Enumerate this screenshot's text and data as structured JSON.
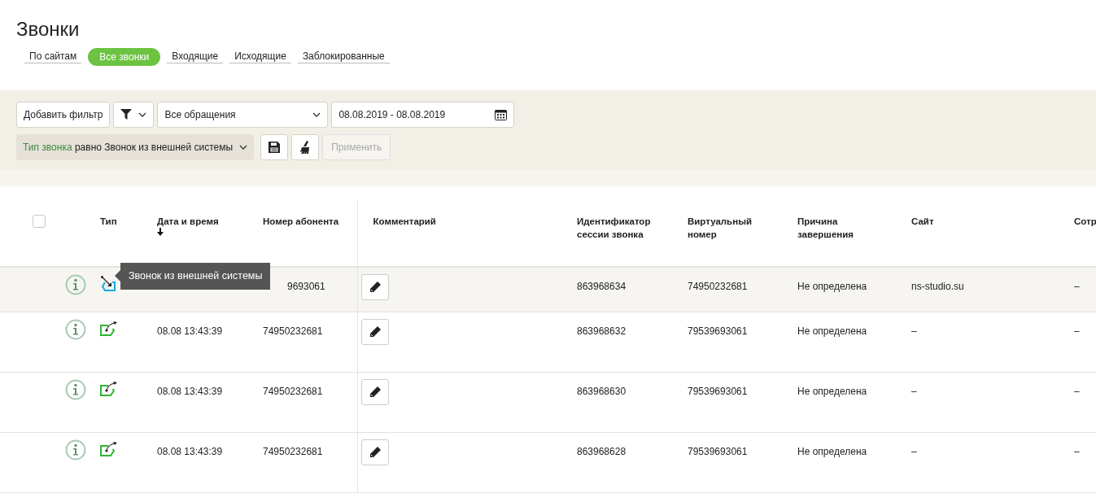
{
  "title": "Звонки",
  "tabs": [
    {
      "label": "По сайтам",
      "selected": false
    },
    {
      "label": "Все звонки",
      "selected": true
    },
    {
      "label": "Входящие",
      "selected": false
    },
    {
      "label": "Исходящие",
      "selected": false
    },
    {
      "label": "Заблокированные",
      "selected": false
    }
  ],
  "filters": {
    "add_button": "Добавить фильтр",
    "request_select": "Все обращения",
    "date_range": "08.08.2019 - 08.08.2019",
    "condition": {
      "field": "Тип звонка",
      "text": "равно Звонок из внешней системы"
    },
    "apply_button": "Применить",
    "apply_disabled": true
  },
  "table": {
    "columns": [
      {
        "label": "Тип",
        "sorted": false
      },
      {
        "label": "Дата и время",
        "sorted": true
      },
      {
        "label": "Номер абонента",
        "sorted": false
      },
      {
        "label": "Комментарий",
        "sorted": false
      },
      {
        "label": "Идентификатор сессии звонка",
        "sorted": false
      },
      {
        "label": "Виртуальный номер",
        "sorted": false
      },
      {
        "label": "Причина завершения",
        "sorted": false
      },
      {
        "label": "Сайт",
        "sorted": false
      },
      {
        "label": "Сотр",
        "sorted": false
      }
    ],
    "select_all_checked": false,
    "rows": [
      {
        "kind": "external",
        "highlighted": true,
        "tooltip": "Звонок из внешней системы",
        "number": "9693061",
        "session": "863968634",
        "virtual": "74950232681",
        "reason": "Не определена",
        "site": "ns-studio.su",
        "employee": "–"
      },
      {
        "kind": "outgoing",
        "highlighted": false,
        "datetime": "08.08 13:43:39",
        "number": "74950232681",
        "session": "863968632",
        "virtual": "79539693061",
        "reason": "Не определена",
        "site": "–",
        "employee": "–"
      },
      {
        "kind": "outgoing",
        "highlighted": false,
        "datetime": "08.08 13:43:39",
        "number": "74950232681",
        "session": "863968630",
        "virtual": "79539693061",
        "reason": "Не определена",
        "site": "–",
        "employee": "–"
      },
      {
        "kind": "outgoing",
        "highlighted": false,
        "datetime": "08.08 13:43:39",
        "number": "74950232681",
        "session": "863968628",
        "virtual": "79539693061",
        "reason": "Не определена",
        "site": "–",
        "employee": "–"
      }
    ]
  }
}
